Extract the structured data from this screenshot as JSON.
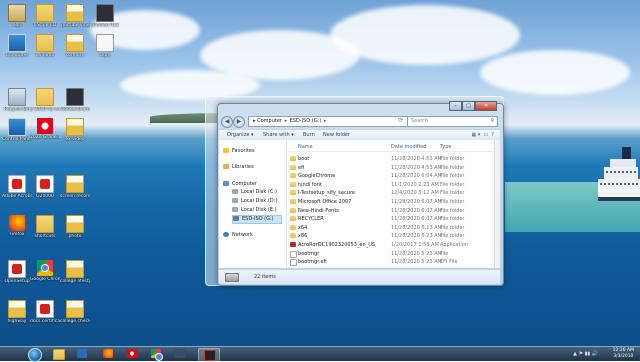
{
  "desktop": {
    "icons": [
      {
        "label": "ado",
        "kind": "user"
      },
      {
        "label": "CS 5.x CD",
        "kind": "folder"
      },
      {
        "label": "youtube videos",
        "kind": "folderdoc"
      },
      {
        "label": "Untitled 012",
        "kind": "darkimg"
      },
      {
        "label": "Computer",
        "kind": "monitor"
      },
      {
        "label": "Winamp",
        "kind": "folder"
      },
      {
        "label": "coreldry",
        "kind": "folderdoc"
      },
      {
        "label": "Ogre",
        "kind": "fileimg"
      },
      {
        "label": "Recycle Bin",
        "kind": "bin"
      },
      {
        "label": "jr 2020 hp eng",
        "kind": "folder"
      },
      {
        "label": "Wondershare UniConverter",
        "kind": "darkimg"
      },
      {
        "label": "Control Panel",
        "kind": "monitor"
      },
      {
        "label": "2020 Grade 1",
        "kind": "opera"
      },
      {
        "label": "ex-video",
        "kind": "folderdoc"
      },
      {
        "label": "Adobe Acrobat...",
        "kind": "pdf"
      },
      {
        "label": "G20000",
        "kind": "pdf"
      },
      {
        "label": "screen recording",
        "kind": "folderdoc"
      },
      {
        "label": "Firefox",
        "kind": "firefox"
      },
      {
        "label": "shortcuts",
        "kind": "folder"
      },
      {
        "label": "photo",
        "kind": "folderdoc"
      },
      {
        "label": "OpenSetup",
        "kind": "pdf"
      },
      {
        "label": "Google Chrome",
        "kind": "chrome"
      },
      {
        "label": "college lifestyle",
        "kind": "folderdoc"
      },
      {
        "label": "highway",
        "kind": "folderdoc"
      },
      {
        "label": "docs certificate",
        "kind": "pdf"
      },
      {
        "label": "college checker",
        "kind": "folderdoc"
      }
    ]
  },
  "explorer": {
    "path": [
      "Computer",
      "ESD-ISO (G:)"
    ],
    "search_placeholder": "Search",
    "toolbar": {
      "organize": "Organize ▾",
      "share": "Share with ▾",
      "burn": "Burn",
      "new_folder": "New folder"
    },
    "nav": {
      "favorites": "Favorites",
      "libraries": "Libraries",
      "computer": "Computer",
      "drives": [
        "Local Disk (C:)",
        "Local Disk (D:)",
        "Local Disk (E:)",
        "ESD-ISO (G:)"
      ],
      "network": "Network"
    },
    "columns": {
      "name": "Name",
      "date": "Date modified",
      "type": "Type"
    },
    "files": [
      {
        "name": "boot",
        "date": "11/28/2020 4:53 AM",
        "type": "File folder",
        "icon": "folder"
      },
      {
        "name": "efi",
        "date": "11/28/2020 4:53 AM",
        "type": "File folder",
        "icon": "folder"
      },
      {
        "name": "GoogleChrome",
        "date": "11/28/2020 6:04 AM",
        "type": "File folder",
        "icon": "folder"
      },
      {
        "name": "hindi font",
        "date": "11/1/2020 2:23 AM",
        "type": "File folder",
        "icon": "folder"
      },
      {
        "name": "I-Testsetup_sify_secure",
        "date": "12/4/2020 3:12 AM",
        "type": "File folder",
        "icon": "folder"
      },
      {
        "name": "Microsoft Office 2007",
        "date": "11/28/2020 6:07 AM",
        "type": "File folder",
        "icon": "folder"
      },
      {
        "name": "New-Hindi-Fonts",
        "date": "11/28/2020 6:07 AM",
        "type": "File folder",
        "icon": "folder"
      },
      {
        "name": "RECYCLER",
        "date": "11/28/2020 6:07 AM",
        "type": "File folder",
        "icon": "folder"
      },
      {
        "name": "x64",
        "date": "11/28/2020 5:13 AM",
        "type": "File folder",
        "icon": "folder"
      },
      {
        "name": "x86",
        "date": "11/28/2020 5:23 AM",
        "type": "File folder",
        "icon": "folder"
      },
      {
        "name": "AcroRdrDC1902320053_en_US",
        "date": "1/20/2017 1:58 AM",
        "type": "Application",
        "icon": "app"
      },
      {
        "name": "bootmgr",
        "date": "11/28/2020 5:23 AM",
        "type": "File",
        "icon": "file"
      },
      {
        "name": "bootmgr.efi",
        "date": "11/28/2020 5:23 AM",
        "type": "EFI File",
        "icon": "file"
      }
    ],
    "status": "22 items"
  },
  "taskbar": {
    "time": "12:26 AM",
    "date": "3/3/2010"
  }
}
